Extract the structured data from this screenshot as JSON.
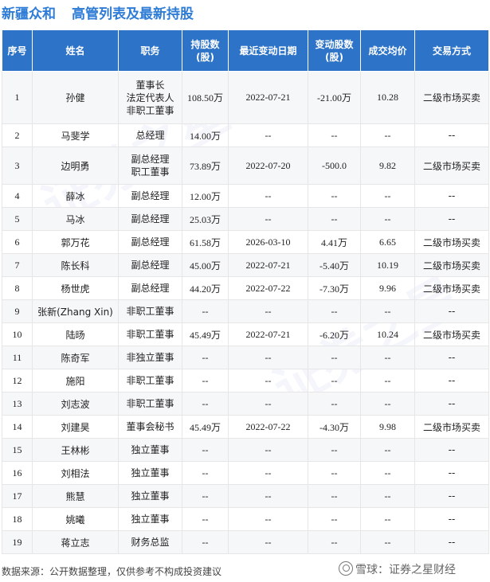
{
  "header": {
    "company": "新疆众和",
    "title": "高管列表及最新持股"
  },
  "columns": [
    "序号",
    "姓名",
    "职务",
    "持股数\n(股)",
    "最近变动日期",
    "变动股数\n(股)",
    "成交均价",
    "交易方式"
  ],
  "rows": [
    {
      "no": "1",
      "name": "孙健",
      "position": "董事长\n法定代表人\n非职工董事",
      "shares": "108.50万",
      "date": "2022-07-21",
      "change": "-21.00万",
      "change_color": "green",
      "price": "10.28",
      "price_color": "green",
      "method": "二级市场买卖",
      "h": "tall"
    },
    {
      "no": "2",
      "name": "马斐学",
      "position": "总经理",
      "shares": "14.00万",
      "date": "--",
      "change": "--",
      "change_color": "",
      "price": "--",
      "price_color": "",
      "method": "--",
      "h": ""
    },
    {
      "no": "3",
      "name": "边明勇",
      "position": "副总经理\n职工董事",
      "shares": "73.89万",
      "date": "2022-07-20",
      "change": "-500.0",
      "change_color": "green",
      "price": "9.82",
      "price_color": "green",
      "method": "二级市场买卖",
      "h": "mid"
    },
    {
      "no": "4",
      "name": "薛冰",
      "position": "副总经理",
      "shares": "12.00万",
      "date": "--",
      "change": "--",
      "change_color": "",
      "price": "--",
      "price_color": "",
      "method": "--",
      "h": ""
    },
    {
      "no": "5",
      "name": "马冰",
      "position": "副总经理",
      "shares": "25.03万",
      "date": "--",
      "change": "--",
      "change_color": "",
      "price": "--",
      "price_color": "",
      "method": "--",
      "h": ""
    },
    {
      "no": "6",
      "name": "郭万花",
      "position": "副总经理",
      "shares": "61.58万",
      "date": "2026-03-10",
      "change": "4.41万",
      "change_color": "red",
      "price": "6.65",
      "price_color": "red",
      "method": "二级市场买卖",
      "h": ""
    },
    {
      "no": "7",
      "name": "陈长科",
      "position": "副总经理",
      "shares": "45.00万",
      "date": "2022-07-21",
      "change": "-5.40万",
      "change_color": "green",
      "price": "10.19",
      "price_color": "green",
      "method": "二级市场买卖",
      "h": ""
    },
    {
      "no": "8",
      "name": "杨世虎",
      "position": "副总经理",
      "shares": "44.20万",
      "date": "2022-07-22",
      "change": "-7.30万",
      "change_color": "green",
      "price": "9.96",
      "price_color": "green",
      "method": "二级市场买卖",
      "h": ""
    },
    {
      "no": "9",
      "name": "张新(Zhang Xin)",
      "position": "非职工董事",
      "shares": "--",
      "date": "--",
      "change": "--",
      "change_color": "",
      "price": "--",
      "price_color": "",
      "method": "--",
      "h": ""
    },
    {
      "no": "10",
      "name": "陆旸",
      "position": "非职工董事",
      "shares": "45.49万",
      "date": "2022-07-21",
      "change": "-6.20万",
      "change_color": "green",
      "price": "10.24",
      "price_color": "green",
      "method": "二级市场买卖",
      "h": ""
    },
    {
      "no": "11",
      "name": "陈奇军",
      "position": "非独立董事",
      "shares": "--",
      "date": "--",
      "change": "--",
      "change_color": "",
      "price": "--",
      "price_color": "",
      "method": "--",
      "h": ""
    },
    {
      "no": "12",
      "name": "施阳",
      "position": "非职工董事",
      "shares": "--",
      "date": "--",
      "change": "--",
      "change_color": "",
      "price": "--",
      "price_color": "",
      "method": "--",
      "h": ""
    },
    {
      "no": "13",
      "name": "刘志波",
      "position": "非职工董事",
      "shares": "--",
      "date": "--",
      "change": "--",
      "change_color": "",
      "price": "--",
      "price_color": "",
      "method": "--",
      "h": ""
    },
    {
      "no": "14",
      "name": "刘建昊",
      "position": "董事会秘书",
      "shares": "45.49万",
      "date": "2022-07-22",
      "change": "-4.30万",
      "change_color": "green",
      "price": "9.98",
      "price_color": "green",
      "method": "二级市场买卖",
      "h": ""
    },
    {
      "no": "15",
      "name": "王林彬",
      "position": "独立董事",
      "shares": "--",
      "date": "--",
      "change": "--",
      "change_color": "",
      "price": "--",
      "price_color": "",
      "method": "--",
      "h": ""
    },
    {
      "no": "16",
      "name": "刘相法",
      "position": "独立董事",
      "shares": "--",
      "date": "--",
      "change": "--",
      "change_color": "",
      "price": "--",
      "price_color": "",
      "method": "--",
      "h": ""
    },
    {
      "no": "17",
      "name": "熊慧",
      "position": "独立董事",
      "shares": "--",
      "date": "--",
      "change": "--",
      "change_color": "",
      "price": "--",
      "price_color": "",
      "method": "--",
      "h": ""
    },
    {
      "no": "18",
      "name": "姚曦",
      "position": "独立董事",
      "shares": "--",
      "date": "--",
      "change": "--",
      "change_color": "",
      "price": "--",
      "price_color": "",
      "method": "--",
      "h": ""
    },
    {
      "no": "19",
      "name": "蒋立志",
      "position": "财务总监",
      "shares": "--",
      "date": "--",
      "change": "--",
      "change_color": "",
      "price": "--",
      "price_color": "",
      "method": "--",
      "h": ""
    }
  ],
  "footer": {
    "source": "数据来源：公开数据整理，仅供参考不构成投资建议",
    "brand": "雪球：证券之星财经"
  },
  "watermark": "证券之星",
  "colors": {
    "header_bg": "#2d73c8",
    "title": "#2e7cd6",
    "up": "#e02020",
    "down": "#19a019"
  }
}
